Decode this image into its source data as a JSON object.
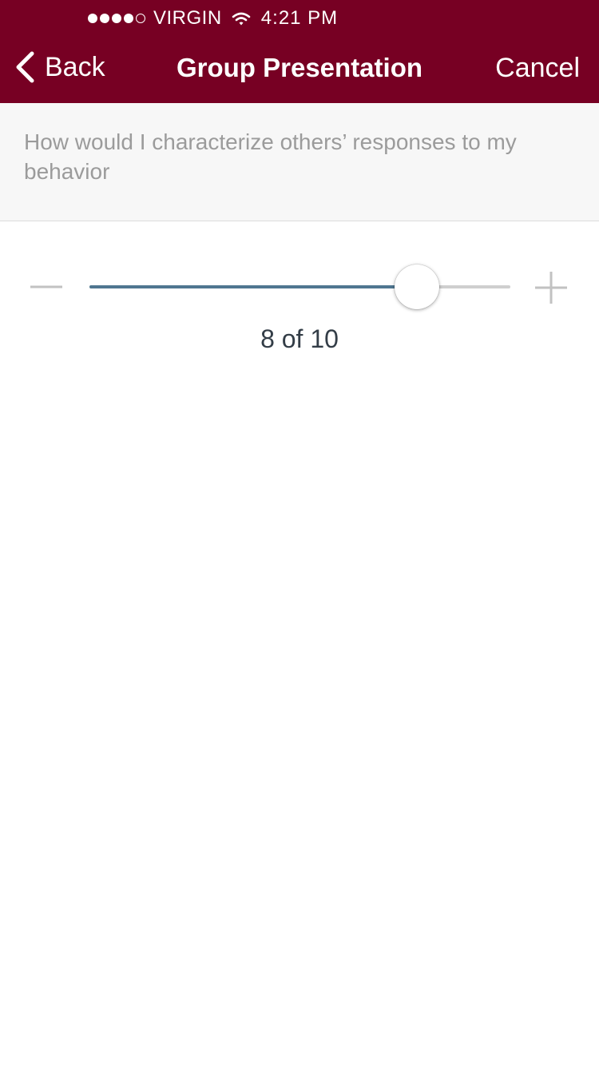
{
  "status_bar": {
    "carrier": "VIRGIN",
    "signal_bars_filled": 4,
    "signal_bars_total": 5,
    "time": "4:21 PM",
    "wifi_icon": "wifi-icon"
  },
  "nav": {
    "back_label": "Back",
    "back_icon": "chevron-left-icon",
    "title": "Group Presentation",
    "cancel_label": "Cancel"
  },
  "question": {
    "text": "How would I characterize others’ responses to my behavior"
  },
  "slider": {
    "value": 8,
    "max": 10,
    "value_text": "8 of 10",
    "decrease_icon": "minus-icon",
    "increase_icon": "plus-icon"
  },
  "colors": {
    "nav_background": "#770023",
    "slider_fill": "#4f7690",
    "slider_track": "#cfcfcf",
    "question_text": "#9b9b9b",
    "value_text": "#333d47"
  }
}
